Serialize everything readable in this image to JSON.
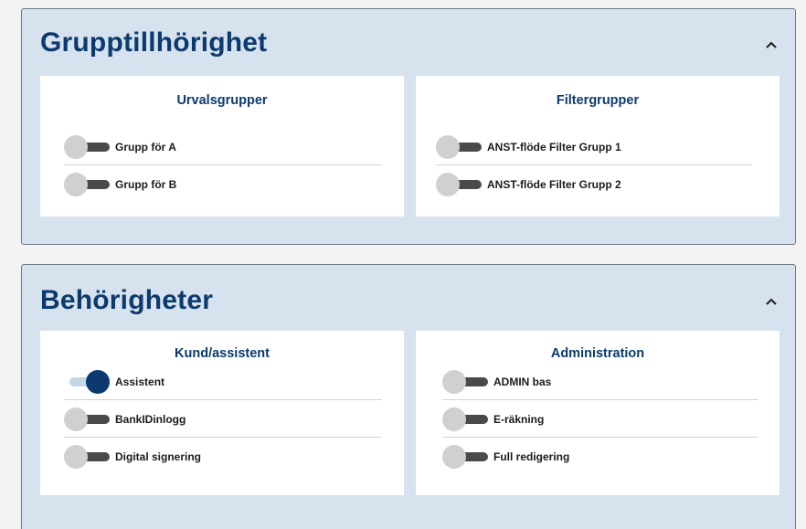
{
  "group_section": {
    "title": "Grupptillhörighet",
    "selection_card": {
      "title": "Urvalsgrupper",
      "items": [
        {
          "label": "Grupp för A",
          "enabled": false
        },
        {
          "label": "Grupp för B",
          "enabled": false
        }
      ]
    },
    "filter_card": {
      "title": "Filtergrupper",
      "items": [
        {
          "label": "ANST-flöde Filter Grupp 1",
          "enabled": false
        },
        {
          "label": "ANST-flöde Filter Grupp 2",
          "enabled": false
        }
      ]
    }
  },
  "permissions_section": {
    "title": "Behörigheter",
    "customer_card": {
      "title": "Kund/assistent",
      "items": [
        {
          "label": "Assistent",
          "enabled": true
        },
        {
          "label": "BankIDinlogg",
          "enabled": false
        },
        {
          "label": "Digital signering",
          "enabled": false
        }
      ]
    },
    "admin_card": {
      "title": "Administration",
      "items": [
        {
          "label": "ADMIN bas",
          "enabled": false
        },
        {
          "label": "E-räkning",
          "enabled": false
        },
        {
          "label": "Full redigering",
          "enabled": false
        }
      ]
    }
  },
  "colors": {
    "heading": "#0c3a6e",
    "panel_background": "#d6e2ed",
    "toggle_on": "#0c3a6e",
    "toggle_off_knob": "#d0d0d0"
  },
  "icons": {
    "collapse": "chevron-up-icon"
  }
}
